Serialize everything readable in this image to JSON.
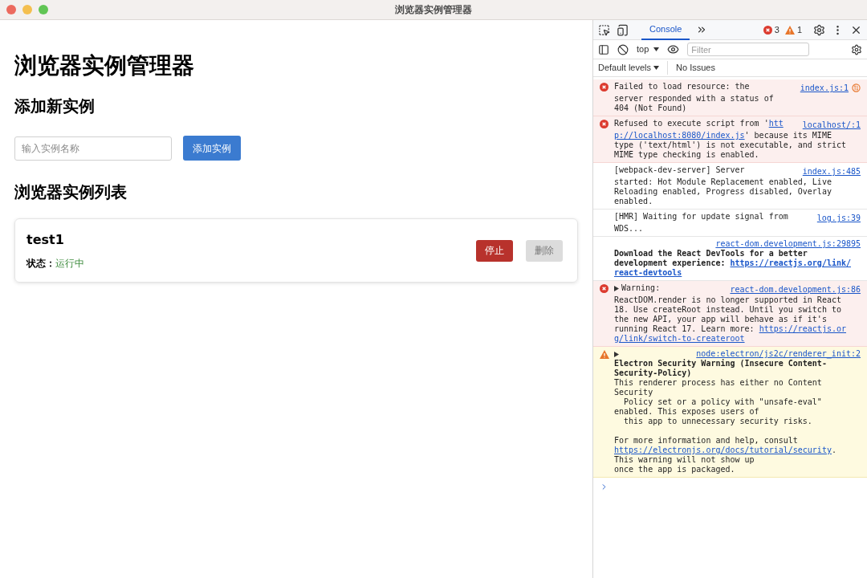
{
  "window": {
    "title": "浏览器实例管理器"
  },
  "app": {
    "heading": "浏览器实例管理器",
    "add_section": {
      "heading": "添加新实例",
      "input": {
        "placeholder": "输入实例名称"
      },
      "button": "添加实例"
    },
    "list_section": {
      "heading": "浏览器实例列表",
      "instances": [
        {
          "name": "test1",
          "status_label": "状态：",
          "status": "运行中",
          "running": true,
          "buttons": [
            {
              "label": "停止",
              "kind": "danger",
              "disabled": false
            },
            {
              "label": "删除",
              "kind": "default",
              "disabled": true
            }
          ]
        }
      ]
    }
  },
  "devtools": {
    "tabs": [
      {
        "label": "Console",
        "selected": true
      }
    ],
    "error_count": "3",
    "warning_count": "1",
    "context": "top",
    "filter": {
      "placeholder": "Filter"
    },
    "levels": "Default levels",
    "issues": "No Issues",
    "messages": [
      {
        "kind": "error",
        "expandable": false,
        "request_icon": true,
        "source": "index.js:1",
        "source_inline": true,
        "paragraphs": [
          [
            [
              {
                "text": "Failed to load resource: the",
                "link": false,
                "bold": false
              }
            ],
            [
              {
                "text": "server responded with a status of",
                "link": false,
                "bold": false
              }
            ],
            [
              {
                "text": "404 (Not Found)",
                "link": false,
                "bold": false
              }
            ]
          ]
        ]
      },
      {
        "kind": "error",
        "expandable": false,
        "request_icon": false,
        "source": "localhost/:1",
        "source_inline": true,
        "paragraphs": [
          [
            [
              {
                "text": "Refused to execute script from '",
                "link": false,
                "bold": false
              },
              {
                "text": "htt",
                "link": true,
                "bold": false
              }
            ],
            [
              {
                "text": "p://localhost:8080/index.js",
                "link": true,
                "bold": false
              },
              {
                "text": "' because its MIME",
                "link": false,
                "bold": false
              }
            ],
            [
              {
                "text": "type ('text/html') is not executable, and strict",
                "link": false,
                "bold": false
              }
            ],
            [
              {
                "text": "MIME type checking is enabled.",
                "link": false,
                "bold": false
              }
            ]
          ]
        ]
      },
      {
        "kind": "info",
        "expandable": false,
        "request_icon": false,
        "source": "index.js:485",
        "source_inline": true,
        "paragraphs": [
          [
            [
              {
                "text": "[webpack-dev-server] Server",
                "link": false,
                "bold": false
              }
            ],
            [
              {
                "text": "started: Hot Module Replacement enabled, Live",
                "link": false,
                "bold": false
              }
            ],
            [
              {
                "text": "Reloading enabled, Progress disabled, Overlay",
                "link": false,
                "bold": false
              }
            ],
            [
              {
                "text": "enabled.",
                "link": false,
                "bold": false
              }
            ]
          ]
        ]
      },
      {
        "kind": "info",
        "expandable": false,
        "request_icon": false,
        "source": "log.js:39",
        "source_inline": true,
        "paragraphs": [
          [
            [
              {
                "text": "[HMR] Waiting for update signal from",
                "link": false,
                "bold": false
              }
            ],
            [
              {
                "text": "WDS...",
                "link": false,
                "bold": false
              }
            ]
          ]
        ]
      },
      {
        "kind": "info",
        "expandable": false,
        "request_icon": false,
        "source": "react-dom.development.js:29895",
        "source_inline": false,
        "paragraphs": [
          [
            [
              {
                "text": "Download the React DevTools for a better",
                "link": false,
                "bold": true
              }
            ],
            [
              {
                "text": "development experience: ",
                "link": false,
                "bold": true
              },
              {
                "text": "https://reactjs.org/link/",
                "link": true,
                "bold": true
              }
            ],
            [
              {
                "text": "react-devtools",
                "link": true,
                "bold": true
              }
            ]
          ]
        ]
      },
      {
        "kind": "error",
        "expandable": true,
        "request_icon": false,
        "source": "react-dom.development.js:86",
        "source_inline": true,
        "paragraphs": [
          [
            [
              {
                "text": "Warning:",
                "link": false,
                "bold": false
              }
            ],
            [
              {
                "text": "ReactDOM.render is no longer supported in React",
                "link": false,
                "bold": false
              }
            ],
            [
              {
                "text": "18. Use createRoot instead. Until you switch to",
                "link": false,
                "bold": false
              }
            ],
            [
              {
                "text": "the new API, your app will behave as if it's",
                "link": false,
                "bold": false
              }
            ],
            [
              {
                "text": "running React 17. Learn more: ",
                "link": false,
                "bold": false
              },
              {
                "text": "https://reactjs.or",
                "link": true,
                "bold": false
              }
            ],
            [
              {
                "text": "g/link/switch-to-createroot",
                "link": true,
                "bold": false
              }
            ]
          ]
        ]
      },
      {
        "kind": "warning",
        "expandable": true,
        "request_icon": false,
        "source": "node:electron/js2c/renderer_init:2",
        "source_inline": false,
        "paragraphs": [
          [
            [
              {
                "text": "Electron Security Warning (Insecure Content-",
                "link": false,
                "bold": true
              }
            ],
            [
              {
                "text": "Security-Policy)",
                "link": false,
                "bold": true
              }
            ],
            [
              {
                "text": "This renderer process has either no Content",
                "link": false,
                "bold": false
              }
            ],
            [
              {
                "text": "Security",
                "link": false,
                "bold": false
              }
            ],
            [
              {
                "text": "  Policy set or a policy with \"unsafe-eval\"",
                "link": false,
                "bold": false
              }
            ],
            [
              {
                "text": "enabled. This exposes users of",
                "link": false,
                "bold": false
              }
            ],
            [
              {
                "text": "  this app to unnecessary security risks.",
                "link": false,
                "bold": false
              }
            ]
          ],
          [
            [
              {
                "text": "For more information and help, consult",
                "link": false,
                "bold": false
              }
            ],
            [
              {
                "text": "https://electronjs.org/docs/tutorial/security",
                "link": true,
                "bold": false
              },
              {
                "text": ".",
                "link": false,
                "bold": false
              }
            ],
            [
              {
                "text": "This warning will not show up",
                "link": false,
                "bold": false
              }
            ],
            [
              {
                "text": "once the app is packaged.",
                "link": false,
                "bold": false
              }
            ]
          ]
        ]
      }
    ]
  }
}
